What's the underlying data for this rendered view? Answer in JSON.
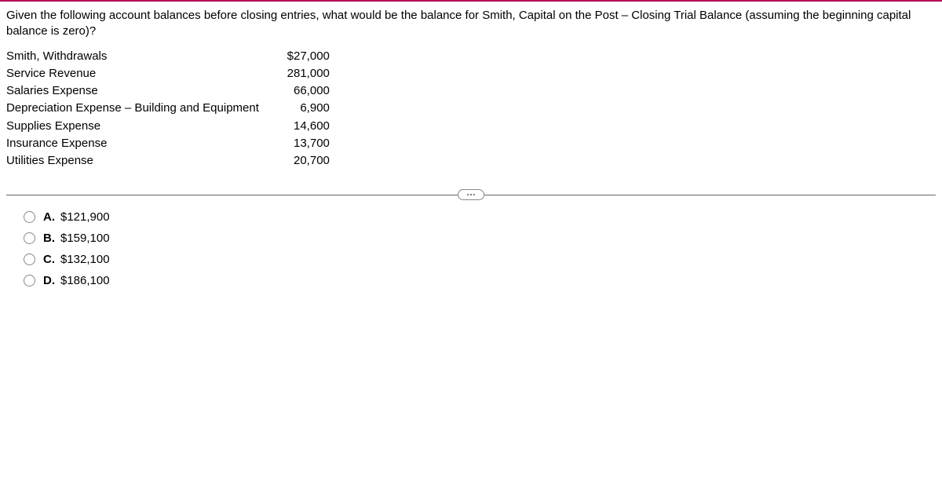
{
  "question": "Given the following account balances before closing entries, what would be the balance for Smith, Capital on the Post – Closing Trial Balance (assuming the beginning capital balance is zero)?",
  "rows": [
    {
      "label": "Smith, Withdrawals",
      "value": "$27,000"
    },
    {
      "label": "Service Revenue",
      "value": "281,000"
    },
    {
      "label": "Salaries Expense",
      "value": "66,000"
    },
    {
      "label": "Depreciation Expense – Building and Equipment",
      "value": "6,900"
    },
    {
      "label": "Supplies Expense",
      "value": "14,600"
    },
    {
      "label": "Insurance Expense",
      "value": "13,700"
    },
    {
      "label": "Utilities Expense",
      "value": "20,700"
    }
  ],
  "options": [
    {
      "letter": "A.",
      "text": "$121,900"
    },
    {
      "letter": "B.",
      "text": "$159,100"
    },
    {
      "letter": "C.",
      "text": "$132,100"
    },
    {
      "letter": "D.",
      "text": "$186,100"
    }
  ]
}
